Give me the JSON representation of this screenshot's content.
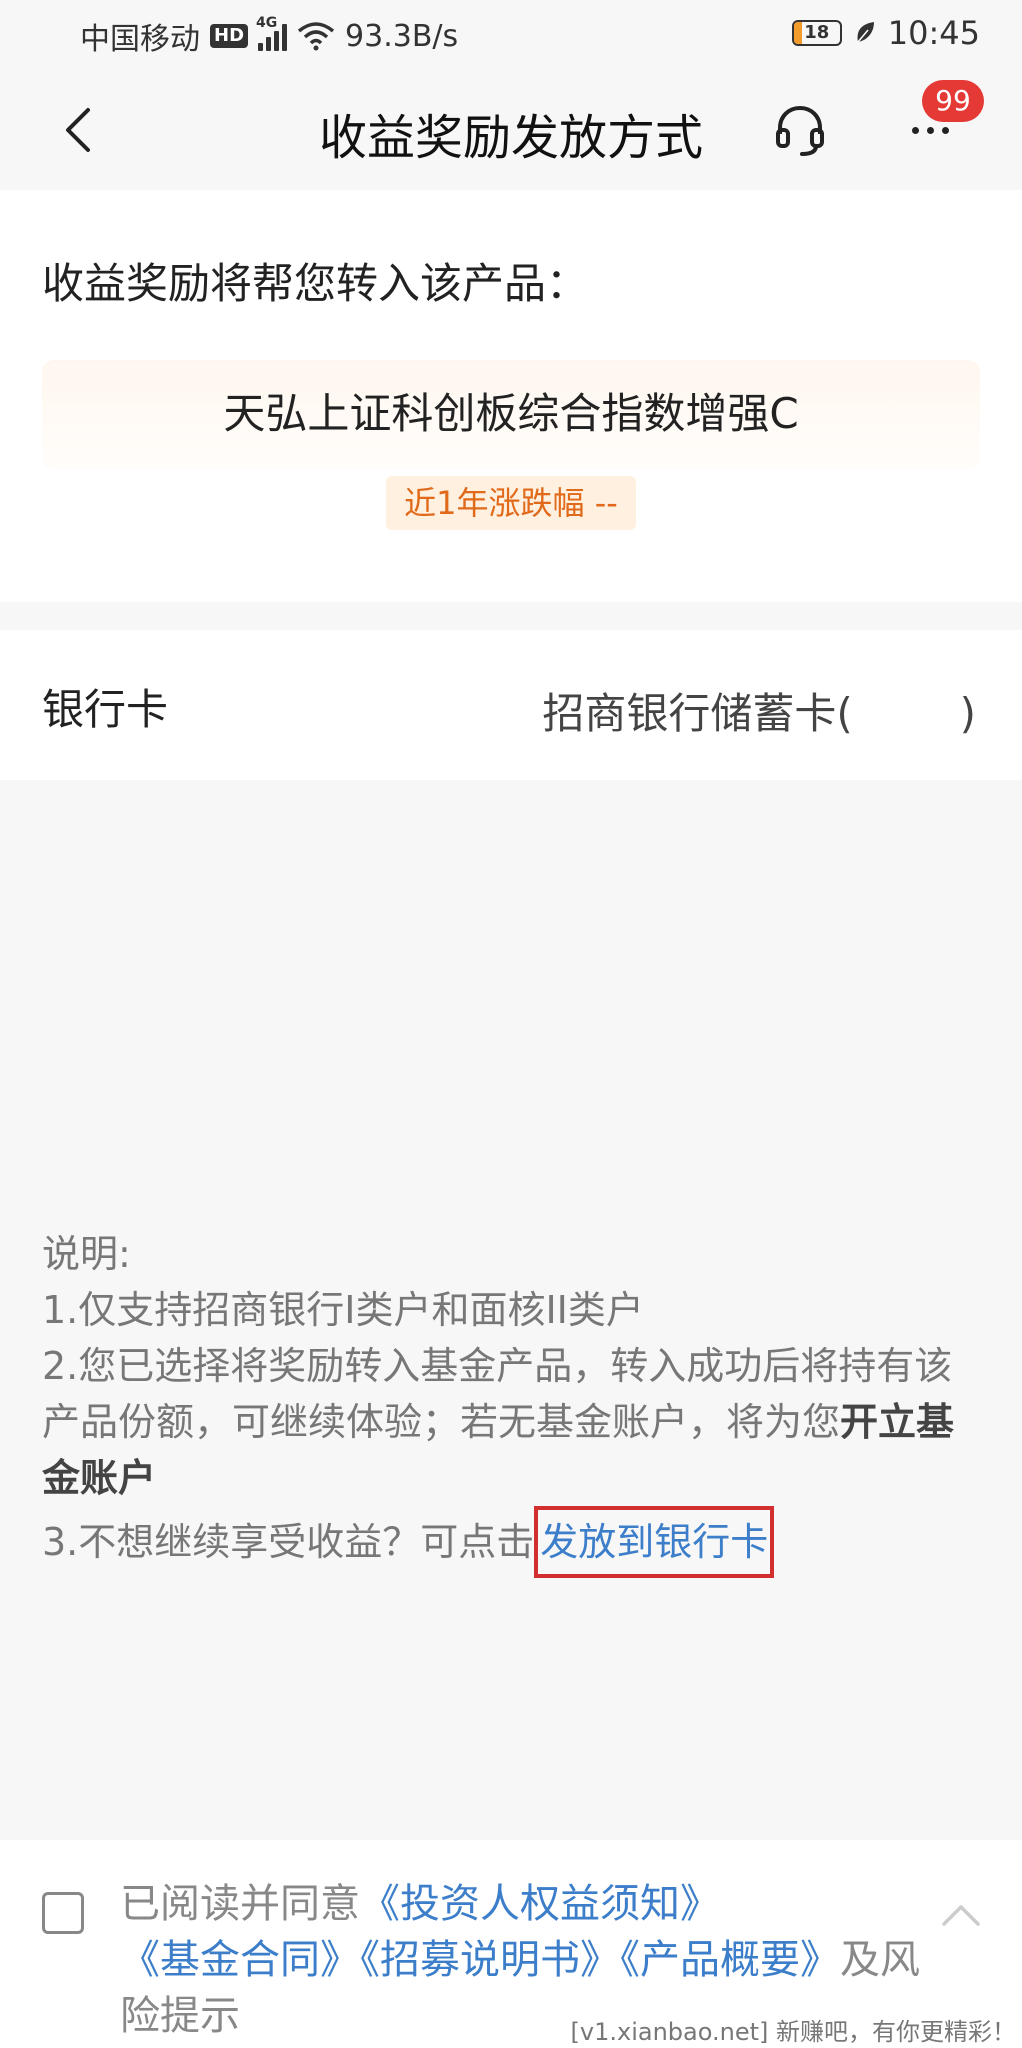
{
  "status_bar": {
    "carrier": "中国移动",
    "hd": "HD",
    "network": "4G",
    "speed": "93.3B/s",
    "battery": "18",
    "battery_color": "#f39b2b",
    "time": "10:45"
  },
  "header": {
    "title": "收益奖励发放方式",
    "badge_count": "99",
    "badge_color": "#e53935"
  },
  "product": {
    "intro": "收益奖励将帮您转入该产品：",
    "name": "天弘上证科创板综合指数增强C",
    "growth_label": "近1年涨跌幅 --"
  },
  "bank": {
    "label": "银行卡",
    "value": "招商银行储蓄卡(        )"
  },
  "notes": {
    "title": "说明:",
    "line1": "1.仅支持招商银行I类户和面核II类户",
    "line2_prefix": "2.您已选择将奖励转入基金产品，转入成功后将持有该产品份额，可继续体验；若无基金账户，将为您",
    "line2_bold": "开立基金账户",
    "line3_prefix": "3.不想继续享受收益？可点击",
    "line3_link": "发放到银行卡"
  },
  "agreement": {
    "prefix": "已阅读并同意",
    "link1": "《投资人权益须知》",
    "link2": "《基金合同》",
    "link3": "《招募说明书》",
    "link4": "《产品概要》",
    "suffix": "及风险提示"
  },
  "watermark": "[v1.xianbao.net] 新赚吧，有你更精彩！"
}
